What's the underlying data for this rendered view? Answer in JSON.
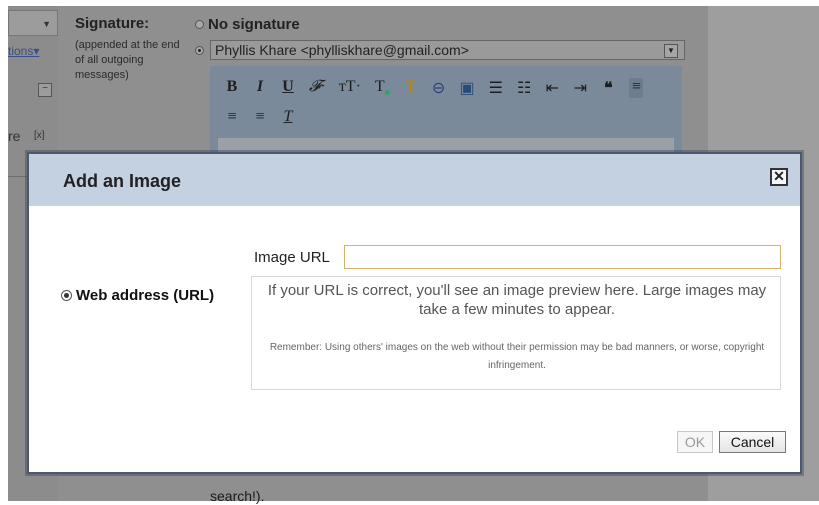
{
  "background": {
    "left_panel": {
      "options_link": "tions▾",
      "truncated_text": "re",
      "close_mark": "[x]"
    },
    "signature": {
      "label": "Signature:",
      "note": "(appended at the end of all outgoing messages)",
      "no_signature": "No signature",
      "selected_signature": "Phyllis Khare <phylliskhare@gmail.com>"
    },
    "toolbar_icons": [
      "bold-icon",
      "italic-icon",
      "underline-icon",
      "font-icon",
      "text-size-icon",
      "text-color-icon",
      "highlight-icon",
      "link-icon",
      "image-icon",
      "numbered-list-icon",
      "bulleted-list-icon",
      "outdent-icon",
      "indent-icon",
      "quote-icon",
      "align-left-icon",
      "align-center-icon",
      "align-right-icon",
      "remove-formatting-icon"
    ],
    "snippets_fragment": "search!)."
  },
  "dialog": {
    "title": "Add an Image",
    "close_glyph": "✕",
    "source_option": "Web address (URL)",
    "url_label": "Image URL",
    "url_value": "",
    "preview_text": "If your URL is correct, you'll see an image preview here. Large images may take a few minutes to appear.",
    "warning_text": "Remember: Using others' images on the web without their permission may be bad manners, or worse, copyright infringement.",
    "ok_label": "OK",
    "cancel_label": "Cancel"
  }
}
